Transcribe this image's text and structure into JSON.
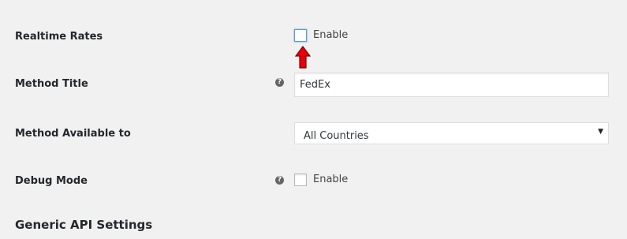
{
  "realtime_rates": {
    "label": "Realtime Rates",
    "checkbox_label": "Enable",
    "checked": false
  },
  "method_title": {
    "label": "Method Title",
    "help_icon": "question-circle-icon",
    "value": "FedEx"
  },
  "method_available_to": {
    "label": "Method Available to",
    "selected": "All Countries",
    "arrow_icon": "chevron-down-icon"
  },
  "debug_mode": {
    "label": "Debug Mode",
    "help_icon": "question-circle-icon",
    "checkbox_label": "Enable",
    "checked": false
  },
  "generic_api_settings": {
    "title": "Generic API Settings"
  },
  "colors": {
    "background": "#f1f1f1",
    "annotation_arrow": "#e8000b",
    "focus_border": "#5b9dd9"
  }
}
